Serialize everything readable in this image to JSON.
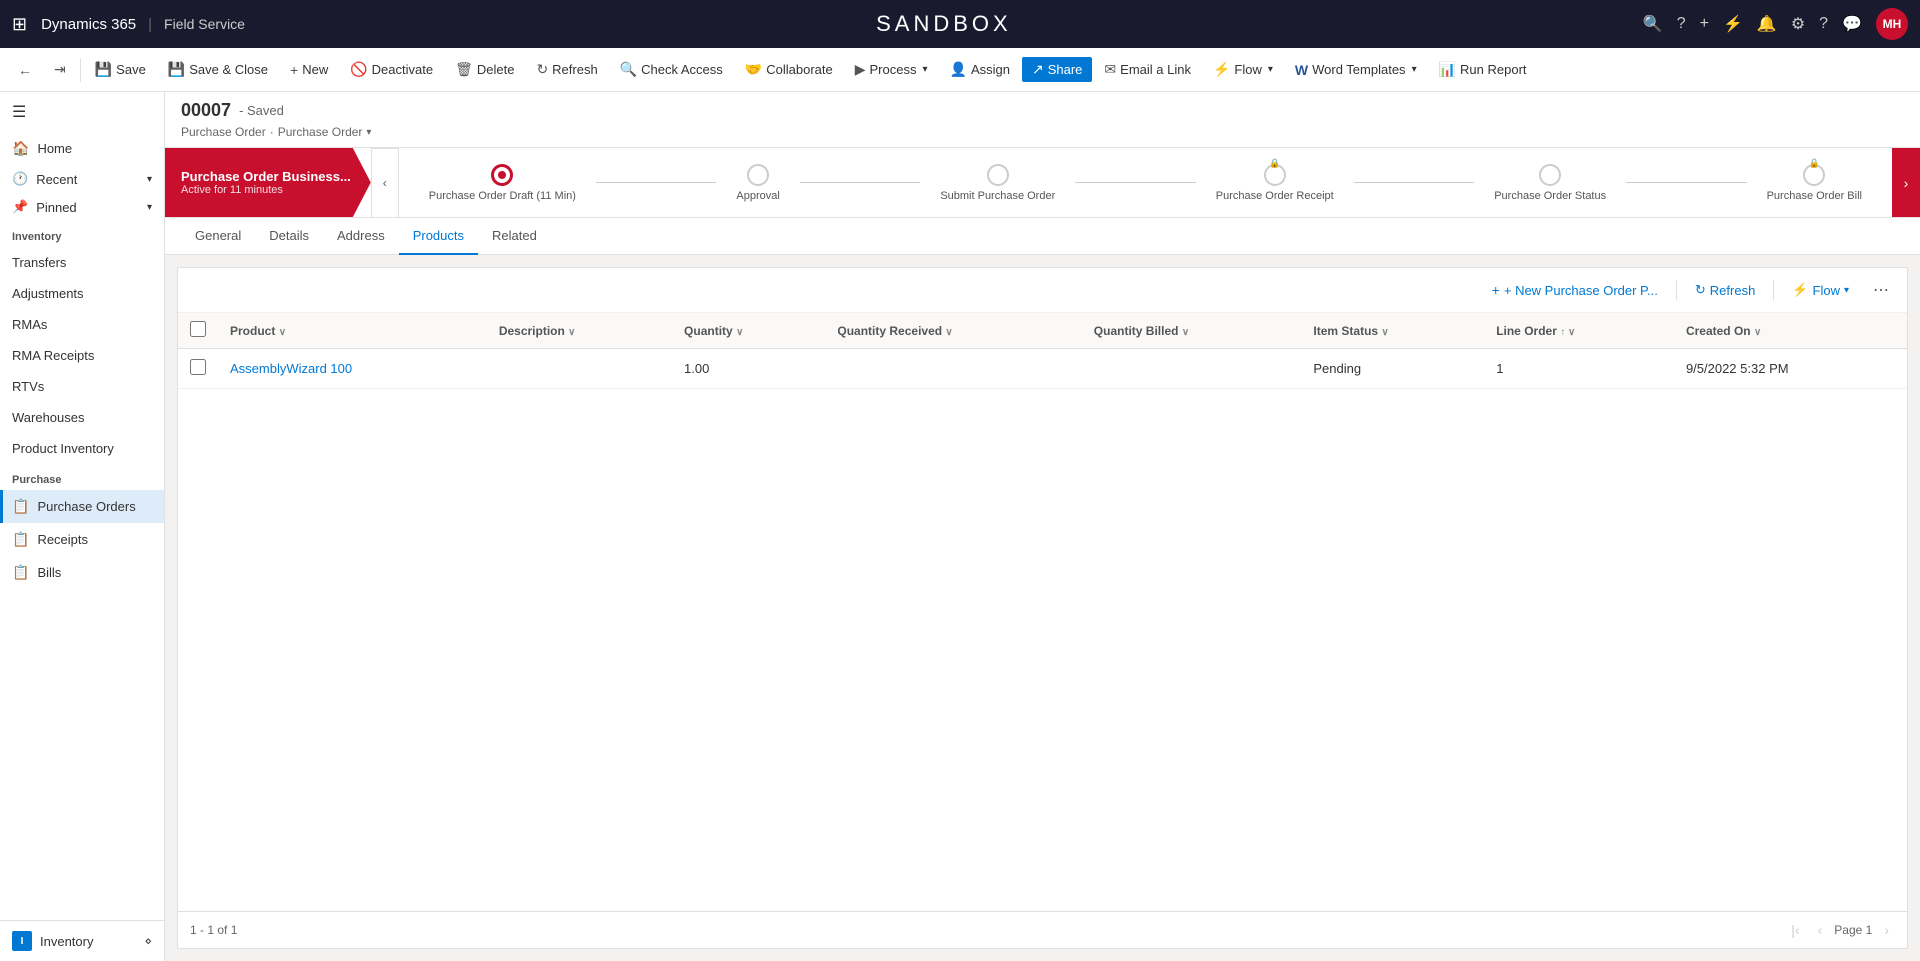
{
  "topNav": {
    "gridIcon": "⊞",
    "brand": "Dynamics 365",
    "brandSep": "|",
    "brandApp": "Field Service",
    "sandboxTitle": "SANDBOX",
    "navIcons": [
      "🔍",
      "?",
      "+",
      "⚡",
      "🔔",
      "⚙",
      "?",
      "💬"
    ],
    "avatar": "MH"
  },
  "toolbar": {
    "backIcon": "←",
    "forwardIcon": "⇥",
    "buttons": [
      {
        "id": "save",
        "icon": "💾",
        "label": "Save"
      },
      {
        "id": "save-close",
        "icon": "💾",
        "label": "Save & Close"
      },
      {
        "id": "new",
        "icon": "+",
        "label": "New"
      },
      {
        "id": "deactivate",
        "icon": "🚫",
        "label": "Deactivate"
      },
      {
        "id": "delete",
        "icon": "🗑",
        "label": "Delete"
      },
      {
        "id": "refresh",
        "icon": "↻",
        "label": "Refresh"
      },
      {
        "id": "check-access",
        "icon": "🔍",
        "label": "Check Access"
      },
      {
        "id": "collaborate",
        "icon": "🤝",
        "label": "Collaborate"
      },
      {
        "id": "process",
        "icon": "▶",
        "label": "Process",
        "hasDropdown": true
      },
      {
        "id": "assign",
        "icon": "👤",
        "label": "Assign"
      },
      {
        "id": "share",
        "icon": "↗",
        "label": "Share",
        "isActive": true
      },
      {
        "id": "email-link",
        "icon": "✉",
        "label": "Email a Link"
      },
      {
        "id": "flow",
        "icon": "⚡",
        "label": "Flow",
        "hasDropdown": true
      },
      {
        "id": "word-templates",
        "icon": "W",
        "label": "Word Templates",
        "hasDropdown": true
      },
      {
        "id": "run-report",
        "icon": "📊",
        "label": "Run Report"
      }
    ]
  },
  "sidebar": {
    "hamburgerIcon": "☰",
    "groups": [
      {
        "id": "home",
        "icon": "🏠",
        "label": "Home"
      },
      {
        "id": "recent",
        "icon": "🕐",
        "label": "Recent",
        "hasChevron": true
      },
      {
        "id": "pinned",
        "icon": "📌",
        "label": "Pinned",
        "hasChevron": true
      }
    ],
    "inventorySection": {
      "label": "Inventory",
      "items": [
        {
          "id": "transfers",
          "label": "Transfers"
        },
        {
          "id": "adjustments",
          "label": "Adjustments"
        },
        {
          "id": "rmas",
          "label": "RMAs"
        },
        {
          "id": "rma-receipts",
          "label": "RMA Receipts"
        },
        {
          "id": "rtvs",
          "label": "RTVs"
        },
        {
          "id": "warehouses",
          "label": "Warehouses"
        },
        {
          "id": "product-inventory",
          "label": "Product Inventory"
        }
      ]
    },
    "purchaseSection": {
      "label": "Purchase",
      "items": [
        {
          "id": "purchase-orders",
          "label": "Purchase Orders",
          "isActive": true
        },
        {
          "id": "receipts",
          "label": "Receipts"
        },
        {
          "id": "bills",
          "label": "Bills"
        }
      ]
    },
    "bottom": {
      "icon": "I",
      "label": "Inventory",
      "chevron": "⋄"
    }
  },
  "record": {
    "id": "00007",
    "statusText": "- Saved",
    "breadcrumb1": "Purchase Order",
    "breadcrumbSep": "·",
    "breadcrumb2": "Purchase Order"
  },
  "processFlow": {
    "activeStage": {
      "name": "Purchase Order Business...",
      "time": "Active for 11 minutes"
    },
    "stages": [
      {
        "id": "draft",
        "label": "Purchase Order Draft  (11 Min)",
        "isActive": true
      },
      {
        "id": "approval",
        "label": "Approval"
      },
      {
        "id": "submit",
        "label": "Submit Purchase Order"
      },
      {
        "id": "receipt",
        "label": "Purchase Order Receipt",
        "hasLock": true
      },
      {
        "id": "status",
        "label": "Purchase Order Status"
      },
      {
        "id": "bill",
        "label": "Purchase Order Bill",
        "hasLock": true
      }
    ]
  },
  "tabs": [
    {
      "id": "general",
      "label": "General"
    },
    {
      "id": "details",
      "label": "Details"
    },
    {
      "id": "address",
      "label": "Address"
    },
    {
      "id": "products",
      "label": "Products",
      "isActive": true
    },
    {
      "id": "related",
      "label": "Related"
    }
  ],
  "productsGrid": {
    "toolbar": {
      "newLabel": "+ New Purchase Order P...",
      "refreshLabel": "Refresh",
      "flowLabel": "Flow",
      "moreIcon": "⋯"
    },
    "columns": [
      {
        "id": "product",
        "label": "Product",
        "sortable": true
      },
      {
        "id": "description",
        "label": "Description",
        "sortable": true
      },
      {
        "id": "quantity",
        "label": "Quantity",
        "sortable": true
      },
      {
        "id": "qty-received",
        "label": "Quantity Received",
        "sortable": true
      },
      {
        "id": "qty-billed",
        "label": "Quantity Billed",
        "sortable": true
      },
      {
        "id": "item-status",
        "label": "Item Status",
        "sortable": true
      },
      {
        "id": "line-order",
        "label": "Line Order",
        "sortable": true,
        "sortDir": "asc"
      },
      {
        "id": "created-on",
        "label": "Created On",
        "sortable": true
      }
    ],
    "rows": [
      {
        "id": "row1",
        "product": "AssemblyWizard 100",
        "description": "",
        "quantity": "1.00",
        "qtyReceived": "",
        "qtyBilled": "",
        "itemStatus": "Pending",
        "lineOrder": "1",
        "createdOn": "9/5/2022 5:32 PM"
      }
    ],
    "footer": {
      "paginationText": "1 - 1 of 1",
      "pageLabel": "Page 1"
    }
  }
}
